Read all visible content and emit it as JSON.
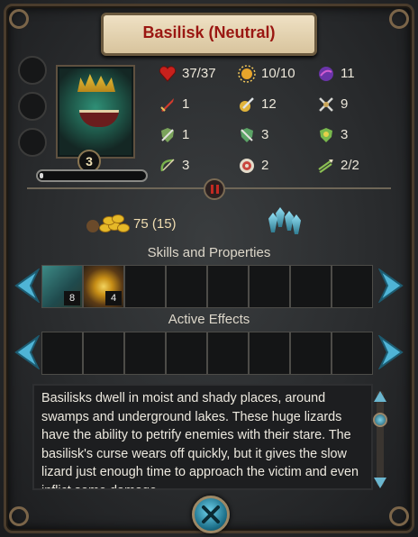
{
  "title": "Basilisk (Neutral)",
  "unit": {
    "level": "3",
    "portrait_icon": "basilisk-portrait"
  },
  "stats": [
    {
      "icon": "health-heart-icon",
      "value": "37/37",
      "color": "#c8211c"
    },
    {
      "icon": "initiative-sun-icon",
      "value": "10/10",
      "color": "#e7a52b"
    },
    {
      "icon": "mana-orb-icon",
      "value": "11",
      "color": "#6a34a8"
    },
    {
      "icon": "attack-sword-icon",
      "value": "1",
      "color": "#d33b2d"
    },
    {
      "icon": "damage-sword-icon",
      "value": "12",
      "color": "#e0b43b"
    },
    {
      "icon": "crossed-swords-icon",
      "value": "9",
      "color": "#caa65a"
    },
    {
      "icon": "defense-shield-icon",
      "value": "1",
      "color": "#7aa35b"
    },
    {
      "icon": "armor-sword-icon",
      "value": "3",
      "color": "#5ba366"
    },
    {
      "icon": "magic-resist-icon",
      "value": "3",
      "color": "#78b84d"
    },
    {
      "icon": "ranged-bow-icon",
      "value": "3",
      "color": "#79b04c"
    },
    {
      "icon": "target-icon",
      "value": "2",
      "color": "#c9473e"
    },
    {
      "icon": "arrows-icon",
      "value": "2/2",
      "color": "#8bbf53"
    }
  ],
  "cost": {
    "gold_icon": "gold-coins-icon",
    "gold_value": "75 (15)",
    "crystal_icon": "crystal-icon"
  },
  "skills_section": {
    "title": "Skills and Properties",
    "slots": [
      {
        "icon": "stone-skin-icon",
        "count": "8"
      },
      {
        "icon": "petrify-eye-icon",
        "count": "4"
      },
      {
        "icon": "",
        "count": ""
      },
      {
        "icon": "",
        "count": ""
      },
      {
        "icon": "",
        "count": ""
      },
      {
        "icon": "",
        "count": ""
      },
      {
        "icon": "",
        "count": ""
      },
      {
        "icon": "",
        "count": ""
      }
    ]
  },
  "effects_section": {
    "title": "Active Effects"
  },
  "description": "Basilisks dwell in moist and shady places, around swamps and underground lakes. These huge lizards have the ability to petrify enemies with their stare. The basilisk's curse wears off quickly, but it gives the slow lizard just enough time to approach the victim and even inflict some damage.",
  "bottom_button_icon": "close-cross-icon"
}
